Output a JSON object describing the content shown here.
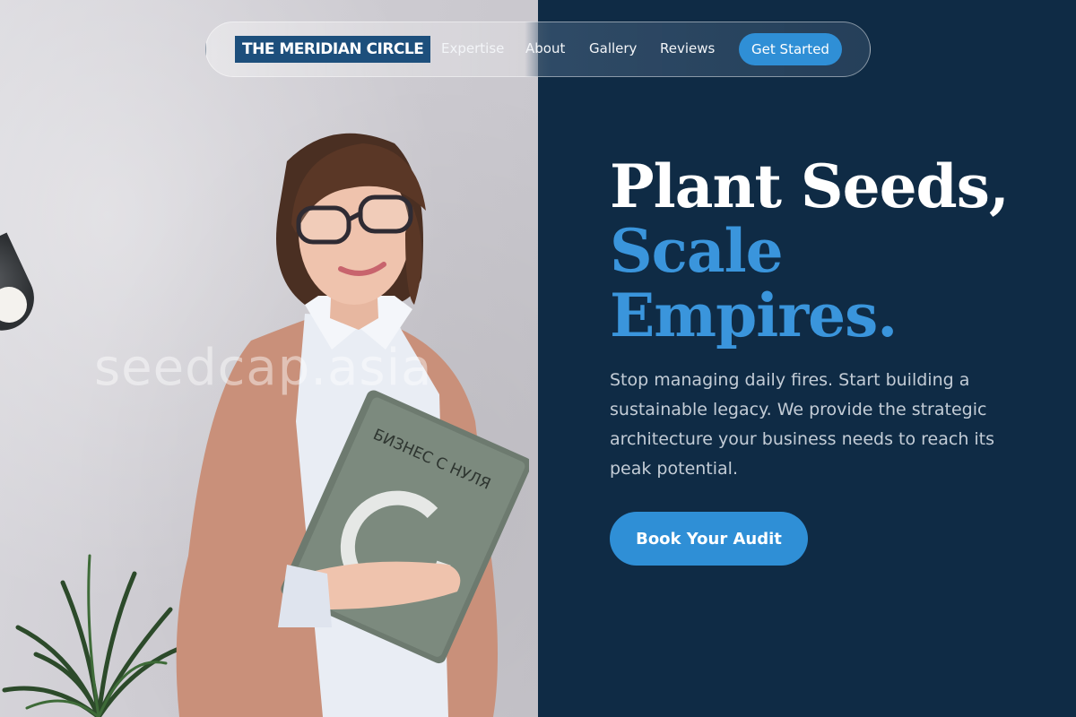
{
  "brand": {
    "logo_text": "THE MERIDIAN CIRCLE",
    "accent_color": "#3a95dc",
    "panel_color": "#0f2b45"
  },
  "nav": {
    "links": [
      "Expertise",
      "About",
      "Gallery",
      "Reviews"
    ],
    "cta_label": "Get Started"
  },
  "hero": {
    "headline_line1": "Plant Seeds,",
    "headline_line2": "Scale",
    "headline_line3": "Empires.",
    "subtext": "Stop managing daily fires. Start building a sustainable legacy. We provide the strategic architecture your business needs to reach its peak potential.",
    "cta_label": "Book Your Audit"
  },
  "photo": {
    "watermark": "seedcap.asia",
    "book_title": "БИЗНЕС С НУЛЯ"
  }
}
